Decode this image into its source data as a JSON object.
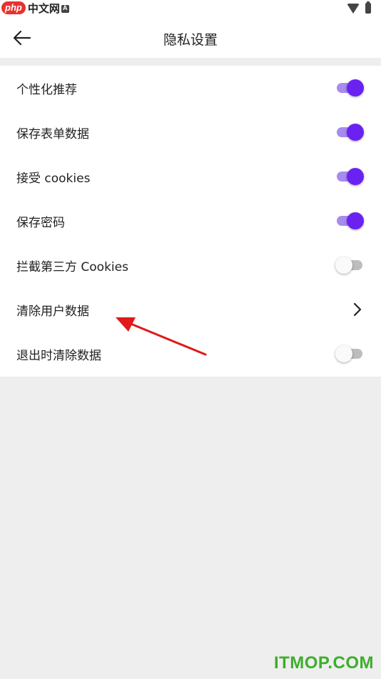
{
  "watermark": {
    "brand": "php",
    "site": "中文网",
    "bottom": "ITMOP.COM"
  },
  "appbar": {
    "title": "隐私设置",
    "back_icon": "arrow-left"
  },
  "settings": [
    {
      "label": "个性化推荐",
      "control": "switch",
      "on": true
    },
    {
      "label": "保存表单数据",
      "control": "switch",
      "on": true
    },
    {
      "label": "接受 cookies",
      "control": "switch",
      "on": true
    },
    {
      "label": "保存密码",
      "control": "switch",
      "on": true
    },
    {
      "label": "拦截第三方 Cookies",
      "control": "switch",
      "on": false
    },
    {
      "label": "清除用户数据",
      "control": "chevron"
    },
    {
      "label": "退出时清除数据",
      "control": "switch",
      "on": false
    }
  ],
  "colors": {
    "accent": "#6a22f2",
    "track_on": "#a78bef",
    "annotation": "#e0191b"
  }
}
